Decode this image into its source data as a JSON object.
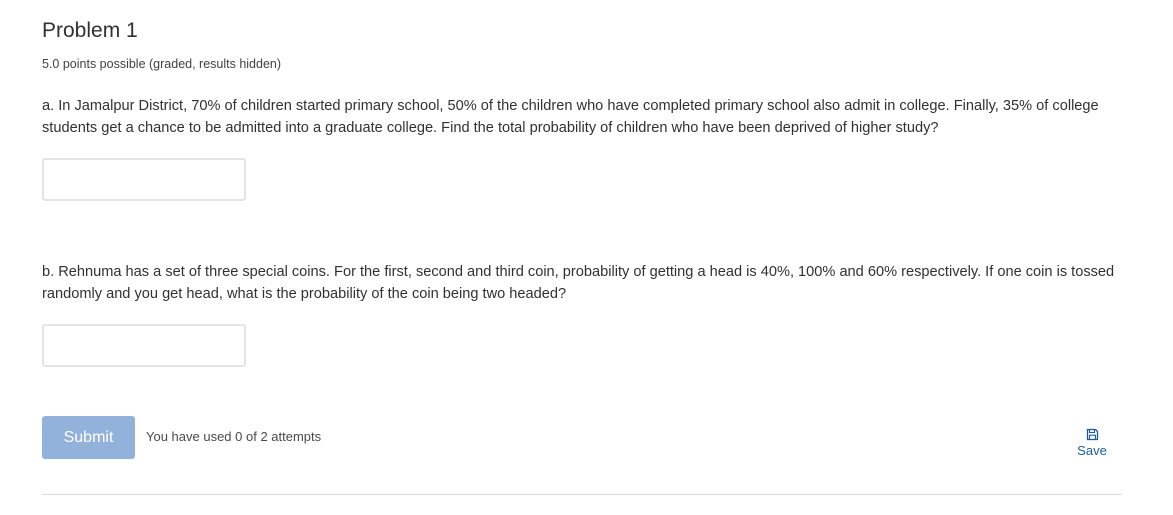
{
  "problem": {
    "title": "Problem 1",
    "points_note": "5.0 points possible (graded, results hidden)",
    "questions": [
      {
        "text": "a. In Jamalpur District, 70% of children started primary school, 50% of the children who have completed primary school also admit in college. Finally, 35% of college students get a chance to be admitted into a graduate college. Find the total probability of children who have been deprived of higher study?",
        "answer_value": ""
      },
      {
        "text": "b. Rehnuma has a set of three special coins. For the first, second and third coin, probability of getting a head is 40%, 100% and 60% respectively. If one coin is tossed randomly and you get head, what is the probability of the coin being two headed?",
        "answer_value": ""
      }
    ]
  },
  "actions": {
    "submit_label": "Submit",
    "attempts_text": "You have used 0 of 2 attempts",
    "save_label": "Save",
    "save_icon": "floppy-disk-icon"
  },
  "colors": {
    "submit_background": "#92b2dc",
    "link": "#1f5b9b"
  }
}
